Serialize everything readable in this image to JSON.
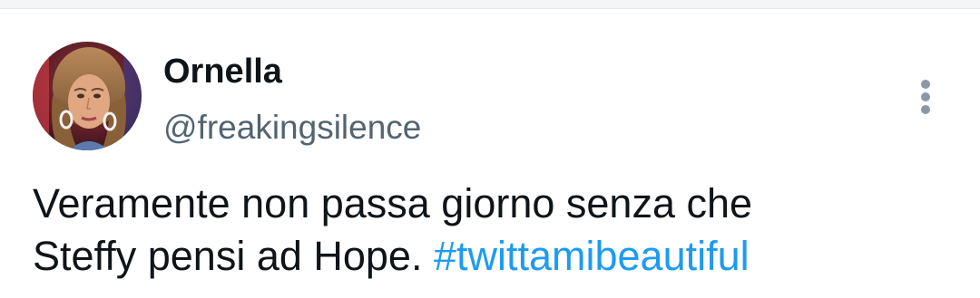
{
  "tweet": {
    "author": {
      "display_name": "Ornella",
      "handle": "@freakingsilence",
      "avatar_icon": "profile-photo"
    },
    "text_line1": "Veramente non passa giorno senza che",
    "text_line2_plain": "Steffy pensi ad Hope. ",
    "hashtag": "#twittamibeautiful",
    "more_icon": "vertical-ellipsis-icon"
  },
  "colors": {
    "text_primary": "#0f1419",
    "text_secondary": "#536471",
    "link": "#1d9bf0",
    "icon_gray": "#8b98a5"
  }
}
